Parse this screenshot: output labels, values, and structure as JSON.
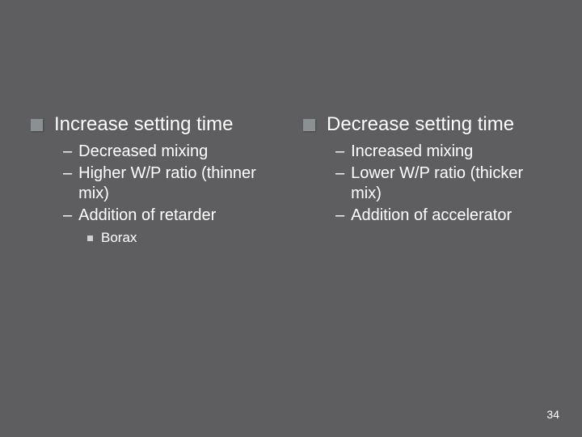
{
  "left": {
    "title": "Increase setting time",
    "sub": [
      "Decreased mixing",
      "Higher W/P ratio (thinner mix)",
      "Addition of retarder"
    ],
    "subsub": [
      "Borax"
    ]
  },
  "right": {
    "title": "Decrease setting time",
    "sub": [
      "Increased mixing",
      "Lower W/P ratio (thicker mix)",
      "Addition of accelerator"
    ]
  },
  "page": "34"
}
